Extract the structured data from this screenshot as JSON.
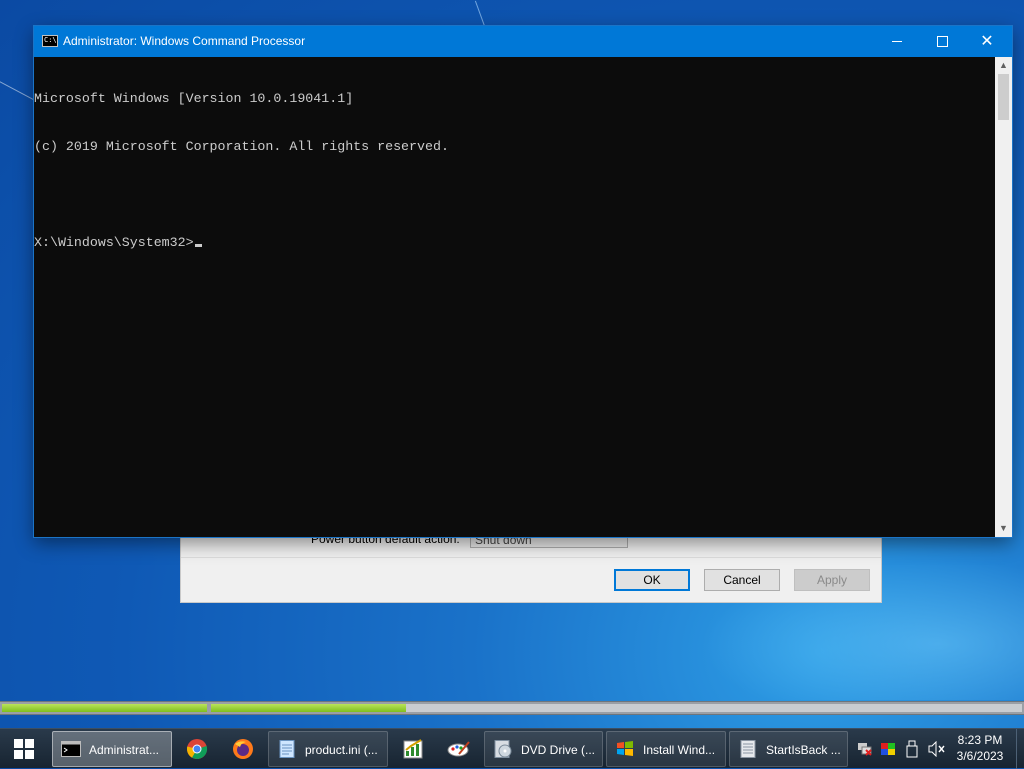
{
  "console": {
    "title": "Administrator: Windows Command Processor",
    "app_icon_text": "C:\\",
    "lines": [
      "Microsoft Windows [Version 10.0.19041.1]",
      "(c) 2019 Microsoft Corporation. All rights reserved.",
      "",
      "X:\\Windows\\System32>"
    ],
    "controls": {
      "minimize": "minimize",
      "maximize": "maximize",
      "close": "✕"
    }
  },
  "dialog": {
    "power_label": "Power button default action:",
    "power_value": "Shut down",
    "ok": "OK",
    "cancel": "Cancel",
    "apply": "Apply"
  },
  "progress": {
    "bar1_fraction": 1.0,
    "bar2_fraction": 0.24
  },
  "taskbar": {
    "items": [
      {
        "label": "Administrat...",
        "icon": "cmd-icon"
      },
      {
        "label": "",
        "icon": "chrome-icon"
      },
      {
        "label": "",
        "icon": "firefox-icon"
      },
      {
        "label": "product.ini (...",
        "icon": "notepad-icon"
      },
      {
        "label": "",
        "icon": "chart-app-icon"
      },
      {
        "label": "",
        "icon": "paint-icon"
      },
      {
        "label": "DVD Drive (...",
        "icon": "dvd-drive-icon"
      },
      {
        "label": "Install Wind...",
        "icon": "windows-setup-icon"
      },
      {
        "label": "StartIsBack ...",
        "icon": "startisback-icon"
      }
    ],
    "tray_icons": [
      "network-disconnected-icon",
      "color-icon",
      "usb-device-icon",
      "volume-muted-icon"
    ],
    "time": "8:23 PM",
    "date": "3/6/2023"
  },
  "colors": {
    "titlebar": "#0078d7",
    "console_bg": "#0c0c0c",
    "console_text": "#cccccc",
    "progress_fill": "#7fbf1e"
  }
}
